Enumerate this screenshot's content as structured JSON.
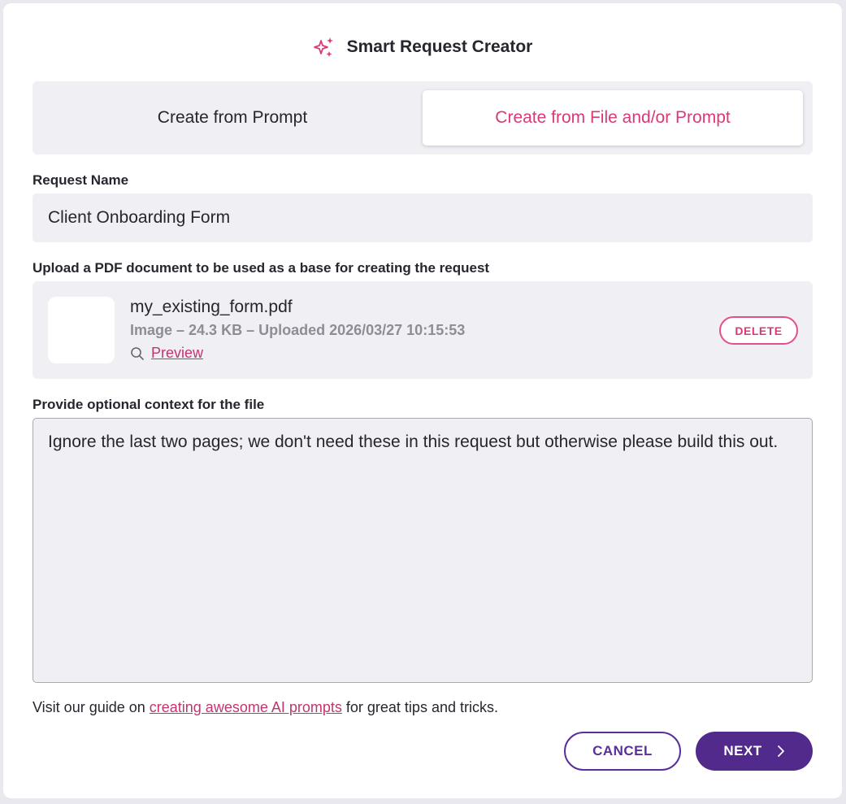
{
  "dialog": {
    "title": "Smart Request Creator",
    "header_icon": "sparkle-icon",
    "accent_color": "#d83a78",
    "primary_color": "#512a8c"
  },
  "tabs": [
    {
      "label": "Create from Prompt",
      "active": false
    },
    {
      "label": "Create from File and/or Prompt",
      "active": true
    }
  ],
  "request_name": {
    "label": "Request Name",
    "value": "Client Onboarding Form"
  },
  "upload": {
    "label": "Upload a PDF document to be used as a base for creating the request",
    "file": {
      "name": "my_existing_form.pdf",
      "meta": "Image – 24.3 KB – Uploaded 2026/03/27 10:15:53",
      "preview_label": "Preview",
      "preview_icon": "search-icon",
      "delete_label": "DELETE"
    }
  },
  "context": {
    "label": "Provide optional context for the file",
    "value": "Ignore the last two pages; we don't need these in this request but otherwise please build this out."
  },
  "guide": {
    "prefix": "Visit our guide on ",
    "link_text": "creating awesome AI prompts",
    "suffix": " for great tips and tricks."
  },
  "actions": {
    "cancel_label": "CANCEL",
    "next_label": "NEXT",
    "next_icon": "chevron-right-icon"
  }
}
